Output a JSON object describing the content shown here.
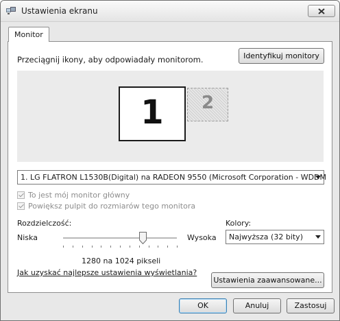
{
  "window": {
    "title": "Ustawienia ekranu",
    "close_icon": "close-icon",
    "app_icon": "display-settings-icon"
  },
  "tabs": [
    {
      "label": "Monitor",
      "selected": true
    }
  ],
  "instruction": "Przeciągnij ikony, aby odpowiadały monitorom.",
  "identify_button": "Identyfikuj monitory",
  "monitors": [
    {
      "label": "1",
      "selected": true
    },
    {
      "label": "2",
      "selected": false
    }
  ],
  "display_select": {
    "value": "1. LG FLATRON L1530B(Digital) na RADEON 9550 (Microsoft Corporation - WDDM"
  },
  "checkboxes": [
    {
      "label": "To jest mój monitor główny",
      "checked": true,
      "disabled": true
    },
    {
      "label": "Powiększ pulpit do rozmiarów tego monitora",
      "checked": true,
      "disabled": true
    }
  ],
  "resolution": {
    "label": "Rozdzielczość:",
    "low_label": "Niska",
    "high_label": "Wysoka",
    "value_text": "1280 na 1024 pikseli",
    "slider_fraction": 0.7
  },
  "colors": {
    "label": "Kolory:",
    "value": "Najwyższa (32 bity)"
  },
  "help_link": "Jak uzyskać najlepsze ustawienia wyświetlania?",
  "advanced_button": "Ustawienia zaawansowane...",
  "buttons": {
    "ok": "OK",
    "cancel": "Anuluj",
    "apply": "Zastosuj"
  }
}
